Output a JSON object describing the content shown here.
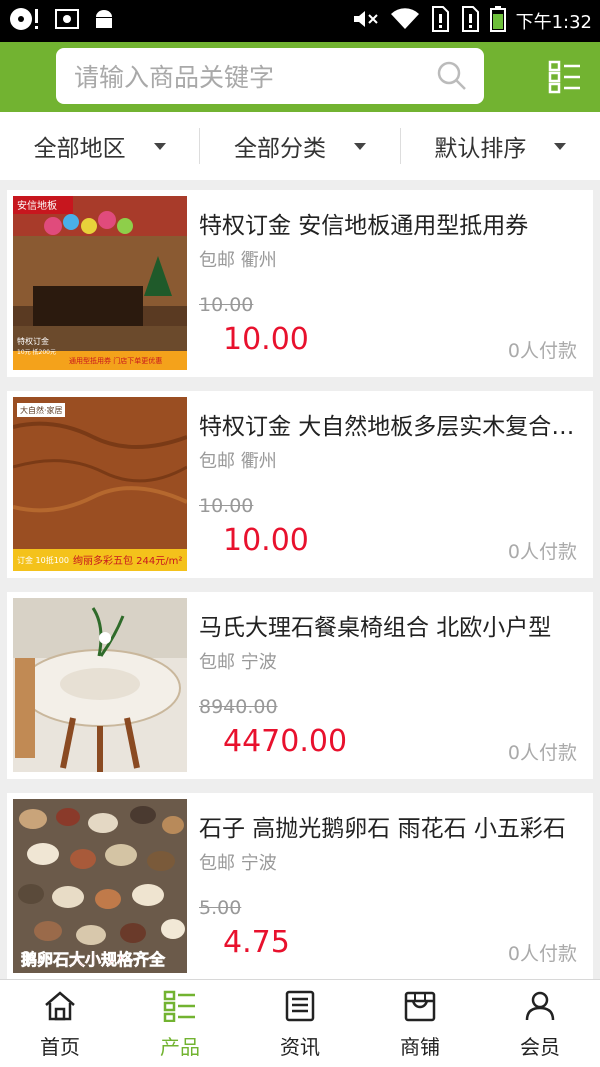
{
  "status_bar": {
    "time": "下午1:32",
    "icons": [
      "music-disc-icon",
      "screenshot-icon",
      "android-icon",
      "mute-icon",
      "wifi-icon",
      "sim1-icon",
      "sim2-icon",
      "battery-icon"
    ]
  },
  "search": {
    "placeholder": "请输入商品关键字"
  },
  "filters": [
    {
      "label": "全部地区"
    },
    {
      "label": "全部分类"
    },
    {
      "label": "默认排序"
    }
  ],
  "products": [
    {
      "title": "特权订金 安信地板通用型抵用券",
      "shipping": "包邮 衢州",
      "old_price": "10.00",
      "price": "10.00",
      "sales": "0人付款",
      "thumb_texts": [
        "安信地板",
        "特权订金",
        "10元 抵200元",
        "通用型抵用券 门店下单更优惠"
      ]
    },
    {
      "title": "特权订金 大自然地板多层实木复合地板",
      "shipping": "包邮 衢州",
      "old_price": "10.00",
      "price": "10.00",
      "sales": "0人付款",
      "thumb_texts": [
        "大自然·家居",
        "订金 10抵100",
        "绚丽多彩五包 244元/m²"
      ]
    },
    {
      "title": "马氏大理石餐桌椅组合 北欧小户型",
      "shipping": "包邮 宁波",
      "old_price": "8940.00",
      "price": "4470.00",
      "sales": "0人付款",
      "thumb_texts": []
    },
    {
      "title": "石子 高抛光鹅卵石 雨花石 小五彩石",
      "shipping": "包邮 宁波",
      "old_price": "5.00",
      "price": "4.75",
      "sales": "0人付款",
      "thumb_texts": [
        "鹅卵石大小规格齐全"
      ]
    }
  ],
  "tabbar": [
    {
      "label": "首页",
      "icon": "home-icon",
      "active": false
    },
    {
      "label": "产品",
      "icon": "product-grid-icon",
      "active": true
    },
    {
      "label": "资讯",
      "icon": "news-icon",
      "active": false
    },
    {
      "label": "商铺",
      "icon": "store-icon",
      "active": false
    },
    {
      "label": "会员",
      "icon": "user-icon",
      "active": false
    }
  ],
  "colors": {
    "brand_green": "#72b331",
    "price_red": "#e8112d"
  }
}
